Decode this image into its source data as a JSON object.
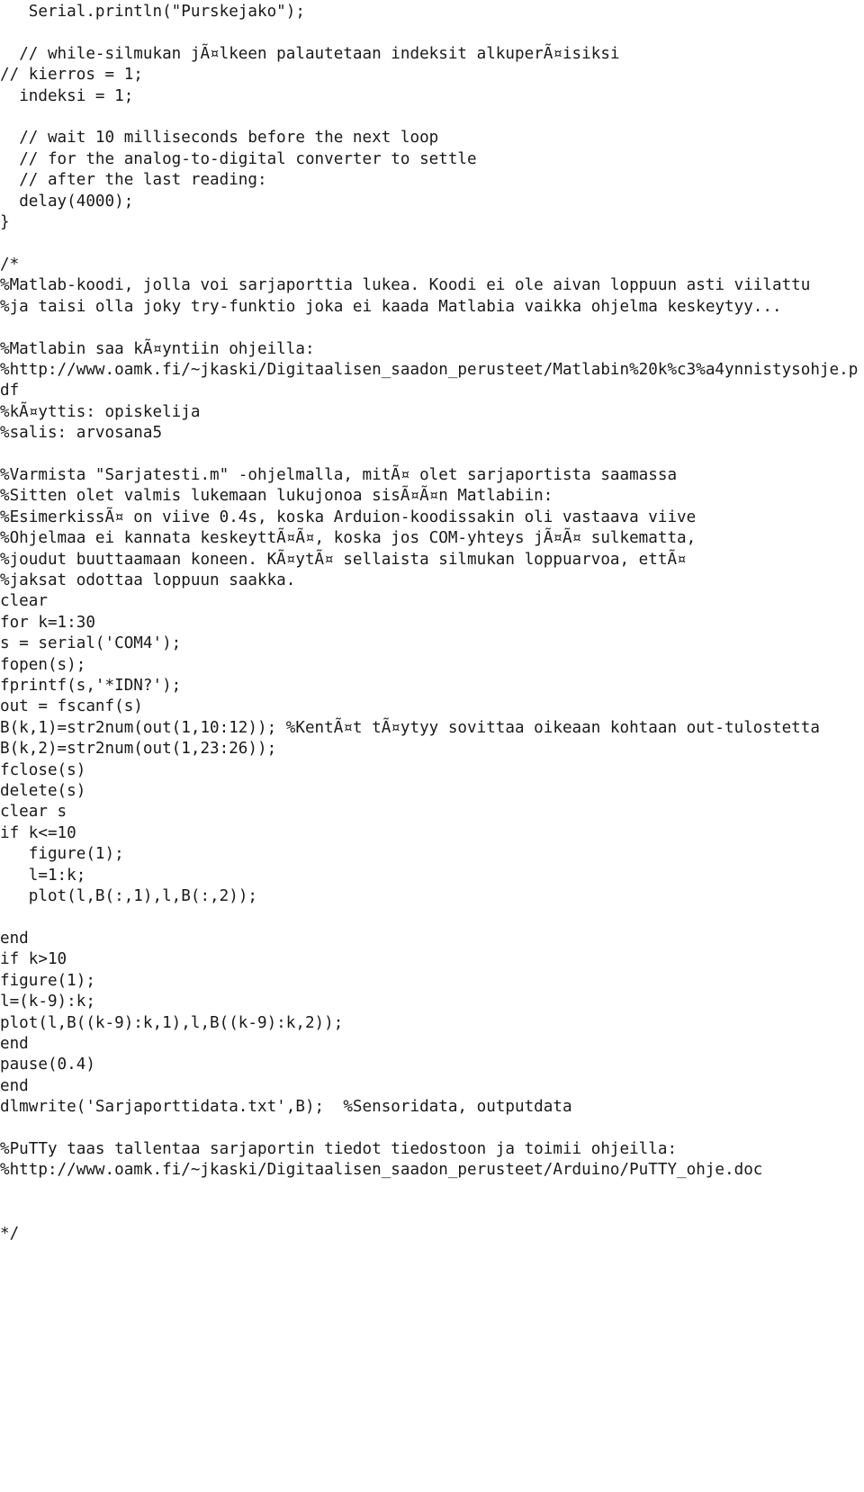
{
  "document": {
    "kind": "plain-text-code-listing",
    "language_hint": "arduino-c-with-embedded-matlab-comment",
    "text_color": "#1a1a1a",
    "background_color": "#ffffff",
    "lines": [
      "   Serial.println(\"Purskejako\");",
      "",
      "  // while-silmukan jÃ¤lkeen palautetaan indeksit alkuperÃ¤isiksi",
      "// kierros = 1;",
      "  indeksi = 1;",
      "",
      "  // wait 10 milliseconds before the next loop",
      "  // for the analog-to-digital converter to settle",
      "  // after the last reading:",
      "  delay(4000);",
      "}",
      "",
      "/*",
      "%Matlab-koodi, jolla voi sarjaporttia lukea. Koodi ei ole aivan loppuun asti viilattu",
      "%ja taisi olla joky try-funktio joka ei kaada Matlabia vaikka ohjelma keskeytyy...",
      "",
      "%Matlabin saa kÃ¤yntiin ohjeilla:",
      "%http://www.oamk.fi/~jkaski/Digitaalisen_saadon_perusteet/Matlabin%20k%c3%a4ynnistysohje.pdf",
      "%kÃ¤yttis: opiskelija",
      "%salis: arvosana5",
      "",
      "%Varmista \"Sarjatesti.m\" -ohjelmalla, mitÃ¤ olet sarjaportista saamassa",
      "%Sitten olet valmis lukemaan lukujonoa sisÃ¤Ã¤n Matlabiin:",
      "%EsimerkissÃ¤ on viive 0.4s, koska Arduion-koodissakin oli vastaava viive",
      "%Ohjelmaa ei kannata keskeyttÃ¤Ã¤, koska jos COM-yhteys jÃ¤Ã¤ sulkematta,",
      "%joudut buuttaamaan koneen. KÃ¤ytÃ¤ sellaista silmukan loppuarvoa, ettÃ¤",
      "%jaksat odottaa loppuun saakka.",
      "clear",
      "for k=1:30",
      "s = serial('COM4');",
      "fopen(s);",
      "fprintf(s,'*IDN?');",
      "out = fscanf(s)",
      "B(k,1)=str2num(out(1,10:12)); %KentÃ¤t tÃ¤ytyy sovittaa oikeaan kohtaan out-tulostetta",
      "B(k,2)=str2num(out(1,23:26));",
      "fclose(s)",
      "delete(s)",
      "clear s",
      "if k<=10",
      "   figure(1);",
      "   l=1:k;",
      "   plot(l,B(:,1),l,B(:,2));",
      "",
      "end",
      "if k>10",
      "figure(1);",
      "l=(k-9):k;",
      "plot(l,B((k-9):k,1),l,B((k-9):k,2));",
      "end",
      "pause(0.4)",
      "end",
      "dlmwrite('Sarjaporttidata.txt',B);  %Sensoridata, outputdata",
      "",
      "%PuTTy taas tallentaa sarjaportin tiedot tiedostoon ja toimii ohjeilla:",
      "%http://www.oamk.fi/~jkaski/Digitaalisen_saadon_perusteet/Arduino/PuTTY_ohje.doc",
      "",
      "",
      "*/"
    ]
  }
}
